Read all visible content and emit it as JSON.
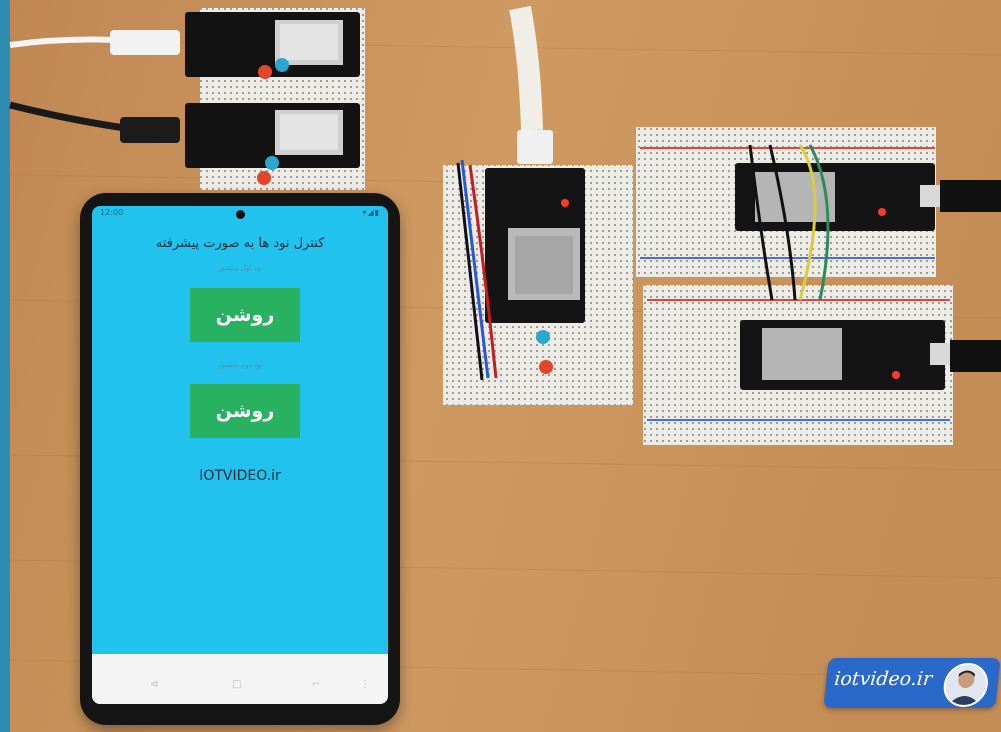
{
  "phone_app": {
    "title": "کنترل نود ها به صورت پیشرفته",
    "node1_label": "نود اول سنسور",
    "node2_label": "نود دوم سنسور",
    "button1_label": "روشن",
    "button2_label": "روشن",
    "footer_text": "IOTVIDEO.ir",
    "status_time": "12:00",
    "status_icons": "▾◢▮"
  },
  "navbar": {
    "icons": [
      "⊲",
      "□",
      "⌐",
      "⋮"
    ]
  },
  "watermark": {
    "text": "iotvideo.ir"
  },
  "colors": {
    "screen": "#22c2ee",
    "button": "#27b160",
    "wood": "#c99155",
    "watermark": "#2a69c9"
  }
}
